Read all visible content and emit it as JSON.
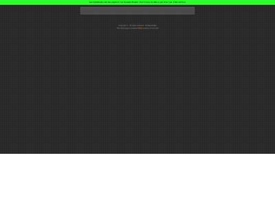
{
  "banner": {
    "message": "Joe-Stylebooks.com has expired. Get Domain Broker. You've may be able to get it for you. Find out how.",
    "background": "#2cff2c"
  },
  "footer": {
    "copyright": "Copyright © · All rights reserved",
    "separator": "·",
    "privacy_link": "Privacy Policy",
    "stats_prefix": "This Web page is created",
    "stats_highlight": "FREE",
    "stats_suffix": "courtesy of Link Slot"
  }
}
